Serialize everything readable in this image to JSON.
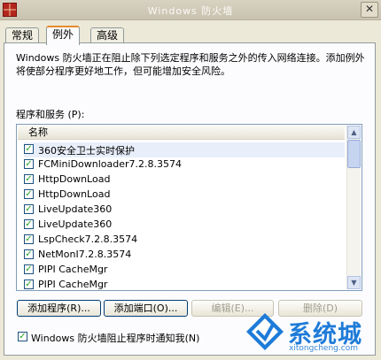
{
  "window": {
    "title": "Windows 防火墙",
    "close_glyph": "✕"
  },
  "tabs": [
    {
      "label": "常规"
    },
    {
      "label": "例外"
    },
    {
      "label": "高级"
    }
  ],
  "description": "Windows 防火墙正在阻止除下列选定程序和服务之外的传入网络连接。添加例外将使部分程序更好地工作，但可能增加安全风险。",
  "list": {
    "label": "程序和服务 (P):",
    "column_header": "名称",
    "items": [
      {
        "label": "360安全卫士实时保护",
        "checked": true
      },
      {
        "label": "FCMiniDownloader7.2.8.3574",
        "checked": true
      },
      {
        "label": "HttpDownLoad",
        "checked": true
      },
      {
        "label": "HttpDownLoad",
        "checked": true
      },
      {
        "label": "LiveUpdate360",
        "checked": true
      },
      {
        "label": "LiveUpdate360",
        "checked": true
      },
      {
        "label": "LspCheck7.2.8.3574",
        "checked": true
      },
      {
        "label": "NetMonI7.2.8.3574",
        "checked": true
      },
      {
        "label": "PIPI CacheMgr",
        "checked": true
      },
      {
        "label": "PIPI CacheMgr",
        "checked": true
      }
    ]
  },
  "buttons": {
    "add_program": "添加程序(R)...",
    "add_port": "添加端口(O)...",
    "edit": "编辑(E)...",
    "delete": "删除(D)"
  },
  "notify": {
    "label": "Windows 防火墙阻止程序时通知我(N)",
    "checked": true
  },
  "watermark": {
    "brand": "系统城",
    "url": "xitongcheng.com"
  },
  "colors": {
    "active_tab_accent": "#e68b2c",
    "watermark_blue": "#1e7bd8",
    "checkmark": "#21a121"
  }
}
